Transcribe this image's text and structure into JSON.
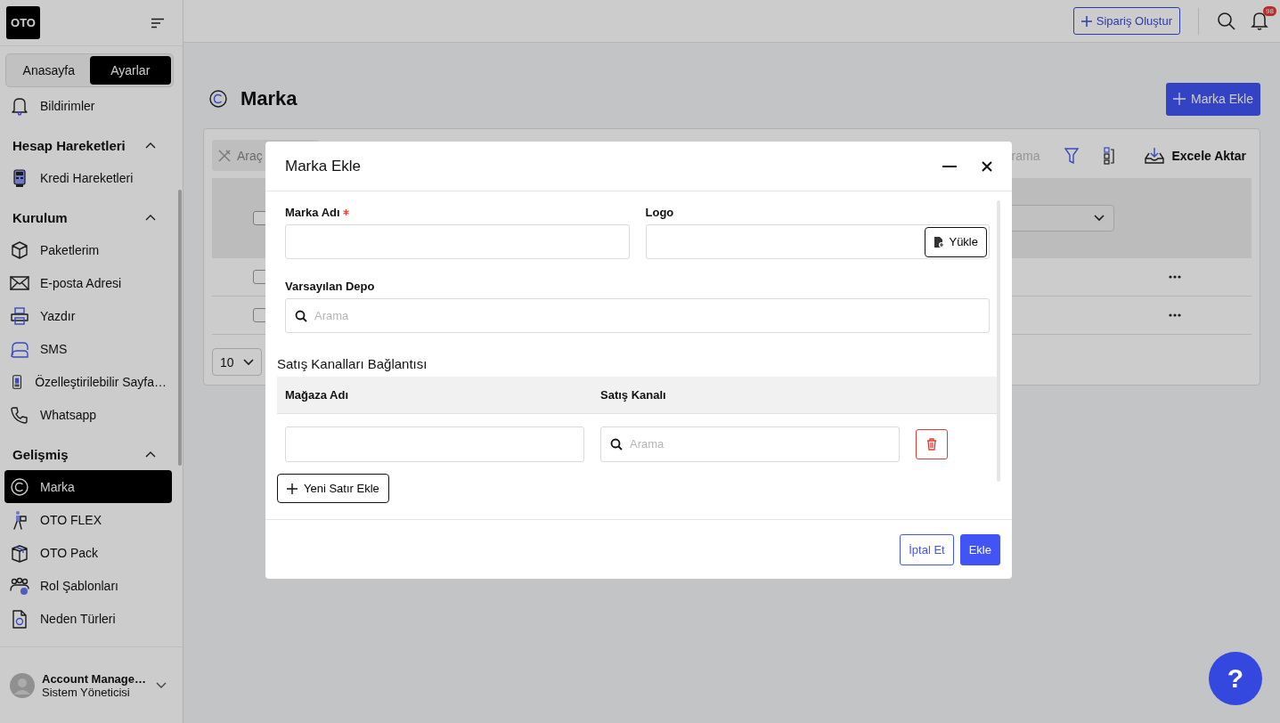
{
  "sidebar": {
    "logo": "OTO",
    "tabs": [
      {
        "label": "Anasayfa",
        "selected": false
      },
      {
        "label": "Ayarlar",
        "selected": true
      }
    ],
    "groups": [
      {
        "items": [
          {
            "label": "Bildirimler",
            "selected": false
          }
        ]
      },
      {
        "title": "Hesap Hareketleri",
        "expanded": true,
        "items": [
          {
            "label": "Kredi Hareketleri",
            "selected": false
          }
        ]
      },
      {
        "title": "Kurulum",
        "expanded": true,
        "items": [
          {
            "label": "Paketlerim",
            "selected": false
          },
          {
            "label": "E-posta Adresi",
            "selected": false
          },
          {
            "label": "Yazdır",
            "selected": false
          },
          {
            "label": "SMS",
            "selected": false
          },
          {
            "label": "Özelleştirilebilir Sayfa…",
            "selected": false
          },
          {
            "label": "Whatsapp",
            "selected": false
          }
        ]
      },
      {
        "title": "Gelişmiş",
        "expanded": true,
        "items": [
          {
            "label": "Marka",
            "selected": true
          },
          {
            "label": "OTO FLEX",
            "selected": false
          },
          {
            "label": "OTO Pack",
            "selected": false
          },
          {
            "label": "Rol Şablonları",
            "selected": false
          },
          {
            "label": "Neden Türleri",
            "selected": false
          }
        ]
      }
    ],
    "account": {
      "name": "Account Manage…",
      "role": "Sistem Yöneticisi"
    }
  },
  "topbar": {
    "create_button": "Sipariş Oluştur",
    "notification_count": "98"
  },
  "page": {
    "title": "Marka",
    "add_button": "Marka Ekle"
  },
  "list": {
    "tools_button": "Araç",
    "search_placeholder": "rama",
    "export_button": "Excele Aktar",
    "header_checked": false,
    "page_size": "10",
    "rows": [
      {
        "checked": false
      },
      {
        "checked": false
      }
    ]
  },
  "modal": {
    "title": "Marka Ekle",
    "fields": [
      {
        "kind": "text",
        "label": "Marka Adı",
        "required": true
      },
      {
        "kind": "upload",
        "label": "Logo",
        "button": "Yükle"
      },
      {
        "kind": "search",
        "label": "Varsayılan Depo",
        "placeholder": "Arama"
      }
    ],
    "section_title": "Satış Kanalları Bağlantısı",
    "columns": [
      "Mağaza Adı",
      "Satış Kanalı"
    ],
    "rows": [
      {
        "placeholder": "Arama"
      }
    ],
    "add_row_button": "Yeni Satır Ekle",
    "buttons": [
      {
        "label": "İptal Et",
        "kind": "secondary"
      },
      {
        "label": "Ekle",
        "kind": "primary"
      }
    ]
  },
  "help_button": "?"
}
